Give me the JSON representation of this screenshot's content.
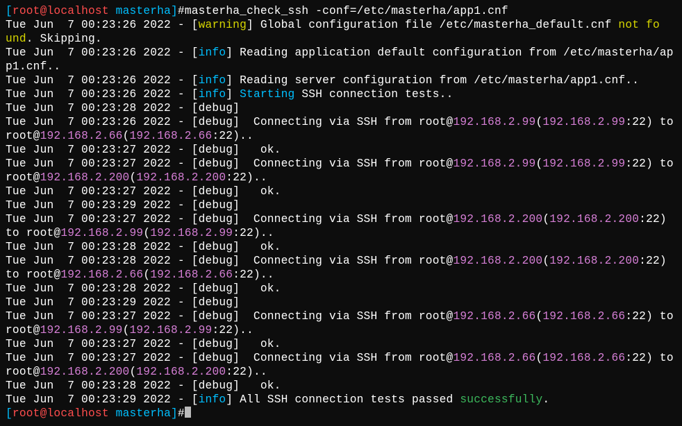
{
  "prompt": {
    "open": "[",
    "user": "root",
    "at": "@",
    "host": "localhost",
    "space": " ",
    "cwd": "masterha",
    "close": "]",
    "hash": "#"
  },
  "command": "masterha_check_ssh -conf=/etc/masterha/app1.cnf",
  "ts": {
    "t26": "Tue Jun  7 00:23:26 2022 - ",
    "t27": "Tue Jun  7 00:23:27 2022 - ",
    "t28": "Tue Jun  7 00:23:28 2022 - ",
    "t29": "Tue Jun  7 00:23:29 2022 - "
  },
  "tag": {
    "warnOpen": "[",
    "warn": "warning",
    "warnClose": "] ",
    "infoOpen": "[",
    "info": "info",
    "infoClose": "] ",
    "debug": "[debug] "
  },
  "msg": {
    "globalA": "Global configuration file /etc/masterha_default.cnf ",
    "globalNotFo": "not fo",
    "globalUnd": "und",
    "globalSkip": ". Skipping.",
    "readApp": "Reading application default configuration from /etc/masterha/app1.cnf..",
    "readServer": "Reading server configuration from /etc/masterha/app1.cnf..",
    "starting": "Starting",
    "sshTests": " SSH connection tests..",
    "connPre": " Connecting via SSH from root@",
    "toRoot": " to root@",
    "ok": "  ok.",
    "allPassed1": "All SSH connection tests passed ",
    "successfully": "successfully",
    "period": "."
  },
  "ip": {
    "ip99": "192.168.2.99",
    "ip66": "192.168.2.66",
    "ip200": "192.168.2.200"
  },
  "port": {
    "p22": ":22)",
    "p22dotdot": ":22).."
  },
  "paren": {
    "open": "(",
    "closeParenBreak": ")"
  }
}
